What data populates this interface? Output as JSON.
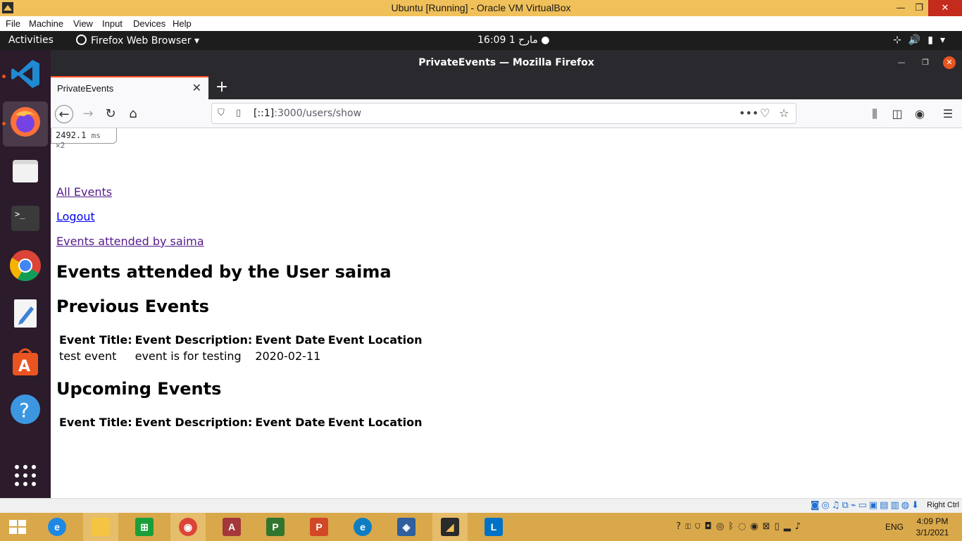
{
  "vbox": {
    "window_title": "Ubuntu [Running] - Oracle VM VirtualBox",
    "menu": [
      "File",
      "Machine",
      "View",
      "Input",
      "Devices",
      "Help"
    ],
    "host_key": "Right Ctrl"
  },
  "gnome": {
    "activities": "Activities",
    "app_menu": "Firefox Web Browser",
    "clock": "مارح 1  16:09"
  },
  "firefox": {
    "window_title": "PrivateEvents — Mozilla Firefox",
    "tab_title": "PrivateEvents",
    "url_host": "[::1]",
    "url_rest": ":3000/users/show"
  },
  "page": {
    "perf_value": "2492.1",
    "perf_unit": "ms",
    "perf_count": "×2",
    "links": {
      "all_events": "All Events",
      "logout": "Logout",
      "events_attended": "Events attended by saima"
    },
    "heading": "Events attended by the User saima",
    "previous_heading": "Previous Events",
    "upcoming_heading": "Upcoming Events",
    "table_headers": [
      "Event Title:",
      "Event Description:",
      "Event Date",
      "Event Location"
    ],
    "previous_rows": [
      [
        "test event",
        "event is for testing",
        "2020-02-11",
        ""
      ]
    ]
  },
  "taskbar": {
    "lang": "ENG",
    "time": "4:09 PM",
    "date": "3/1/2021"
  },
  "colors": {
    "vbox_titlebar": "#f0c05a",
    "win_taskbar": "#d9a84a",
    "ubuntu_orange": "#e95420",
    "visited_link": "#551a8b"
  }
}
